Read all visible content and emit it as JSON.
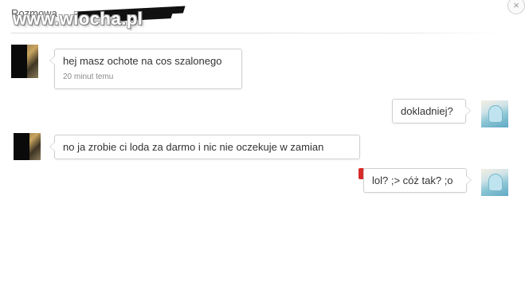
{
  "header": {
    "title": "Rozmowa",
    "watermark": "www.wiocha.pl",
    "close_label": "×"
  },
  "messages": [
    {
      "side": "left",
      "text": "hej masz ochote na cos szalonego",
      "time": "20 minut temu"
    },
    {
      "side": "right",
      "text": "dokladniej?"
    },
    {
      "side": "left",
      "text": "no ja zrobie ci loda za darmo i nic nie oczekuje w zamian"
    },
    {
      "side": "right",
      "text": "lol? ;> cóż tak? ;o"
    }
  ],
  "colors": {
    "bubble_border": "#cfcfcf",
    "text": "#333333",
    "timestamp": "#8a8a8a",
    "unread_marker": "#d92b2b"
  }
}
